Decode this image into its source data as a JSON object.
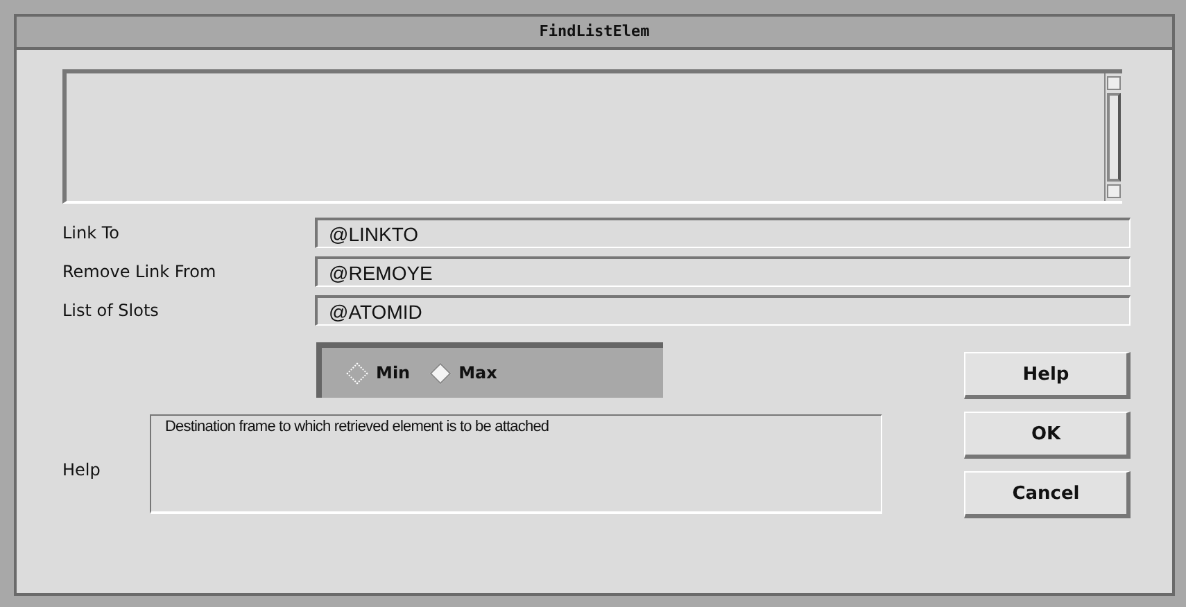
{
  "window": {
    "title": "FindListElem"
  },
  "fields": [
    {
      "label": "Link To",
      "value": "@LINKTO"
    },
    {
      "label": "Remove Link From",
      "value": "@REMOYE"
    },
    {
      "label": "List of Slots",
      "value": "@ATOMID"
    }
  ],
  "radios": [
    {
      "label": "Min",
      "selected": false
    },
    {
      "label": "Max",
      "selected": true
    }
  ],
  "help": {
    "label": "Help",
    "text": "Destination frame to which retrieved element is to be attached"
  },
  "buttons": [
    "Help",
    "OK",
    "Cancel"
  ]
}
